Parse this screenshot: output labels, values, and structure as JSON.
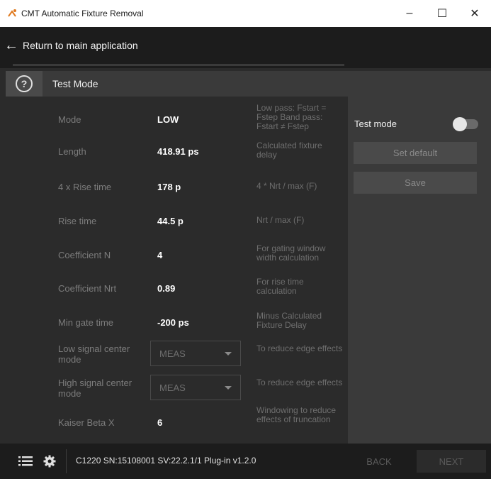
{
  "window": {
    "title": "CMT Automatic Fixture Removal",
    "icon": "cmt-app-icon",
    "controls": [
      "minimize",
      "maximize",
      "close"
    ]
  },
  "nav": {
    "back_label": "Return to main application",
    "back_icon": "arrow-left-icon"
  },
  "section": {
    "title": "Test Mode",
    "help_icon": "help-icon"
  },
  "rows": [
    {
      "label": "Mode",
      "value": "LOW",
      "desc": "Low pass: Fstart = Fstep Band pass: Fstart ≠ Fstep"
    },
    {
      "label": "Length",
      "value": "418.91 ps",
      "desc": "Calculated fixture delay"
    },
    {
      "label": "4 x Rise time",
      "value": "178 p",
      "desc": "4 * Nrt / max (F)"
    },
    {
      "label": "Rise time",
      "value": "44.5 p",
      "desc": "Nrt / max (F)"
    },
    {
      "label": "Coefficient N",
      "value": "4",
      "desc": "For gating window width calculation"
    },
    {
      "label": "Coefficient Nrt",
      "value": "0.89",
      "desc": "For rise time calculation"
    },
    {
      "label": "Min gate time",
      "value": "-200 ps",
      "desc": "Minus Calculated Fixture Delay"
    },
    {
      "label": "Low signal center mode",
      "dropdown": "MEAS",
      "desc": "To reduce edge effects"
    },
    {
      "label": "High signal center mode",
      "dropdown": "MEAS",
      "desc": "To reduce edge effects"
    },
    {
      "label": "Kaiser Beta X",
      "value": "6",
      "desc": "Windowing to reduce effects of truncation"
    }
  ],
  "panel": {
    "test_mode_label": "Test mode",
    "test_mode_on": false,
    "set_default_label": "Set default",
    "save_label": "Save"
  },
  "footer": {
    "status": "C1220 SN:15108001 SV:22.2.1/1 Plug-in v1.2.0",
    "back_label": "BACK",
    "next_label": "NEXT",
    "list_icon": "list-icon",
    "settings_icon": "gear-icon"
  },
  "colors": {
    "background": "#2b2b2b",
    "panel": "#3a3a3a",
    "bar": "#1c1c1c",
    "label": "#7c7c7c",
    "value": "#ffffff"
  }
}
